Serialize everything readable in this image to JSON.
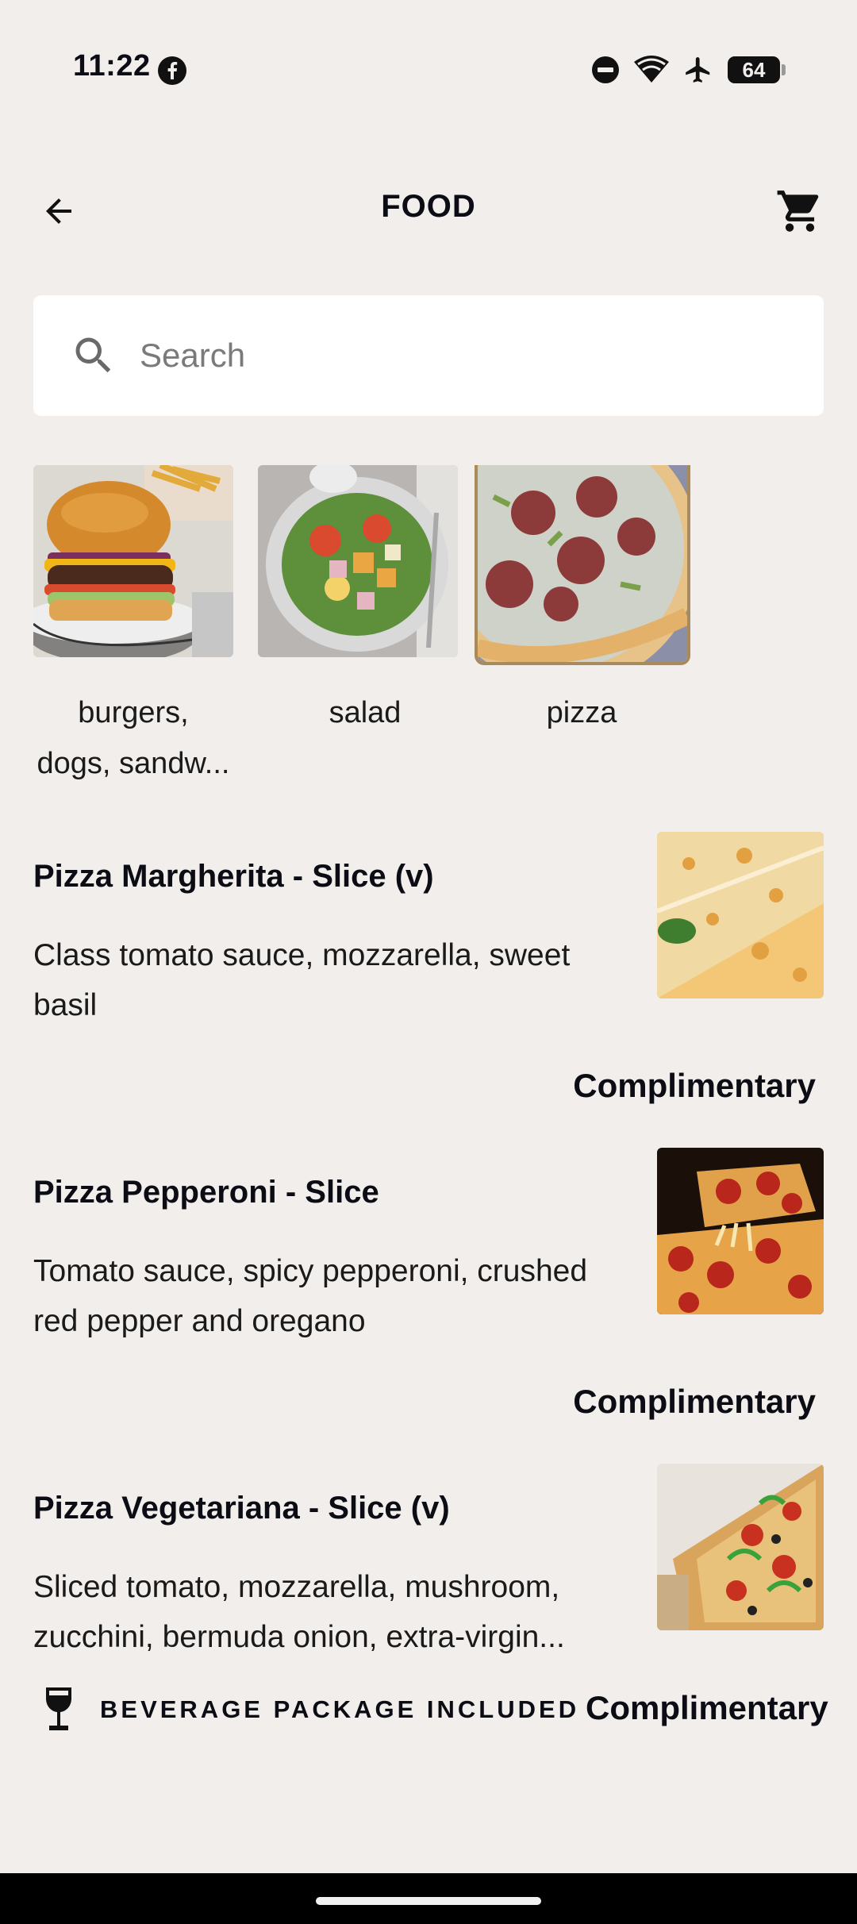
{
  "status_bar": {
    "time": "11:22",
    "battery": "64",
    "icons": [
      "facebook-icon",
      "do-not-disturb-icon",
      "wifi-icon",
      "airplane-icon",
      "battery-icon"
    ]
  },
  "header": {
    "title": "FOOD",
    "back_icon": "arrow-left-icon",
    "cart_icon": "shopping-cart-icon"
  },
  "search": {
    "placeholder": "Search",
    "value": ""
  },
  "categories": [
    {
      "label": "burgers, dogs, sandw...",
      "line1": "burgers,",
      "line2": "dogs, sandw...",
      "selected": false
    },
    {
      "label": "salad",
      "selected": false
    },
    {
      "label": "pizza",
      "selected": true
    }
  ],
  "items": [
    {
      "name": "Pizza Margherita - Slice (v)",
      "description": "Class tomato sauce, mozzarella, sweet basil",
      "price": "Complimentary"
    },
    {
      "name": "Pizza Pepperoni - Slice",
      "description": "Tomato sauce, spicy pepperoni, crushed red pepper and oregano",
      "price": "Complimentary"
    },
    {
      "name": "Pizza Vegetariana - Slice (v)",
      "description": "Sliced tomato, mozzarella, mushroom, zucchini, bermuda onion, extra-virgin...",
      "price": "Complimentary"
    }
  ],
  "banner": {
    "text": "BEVERAGE PACKAGE INCLUDED",
    "icon": "wine-glass-icon"
  },
  "colors": {
    "background": "#f1eeec",
    "selected_border": "#a88a5b",
    "text": "#0c0d14"
  }
}
